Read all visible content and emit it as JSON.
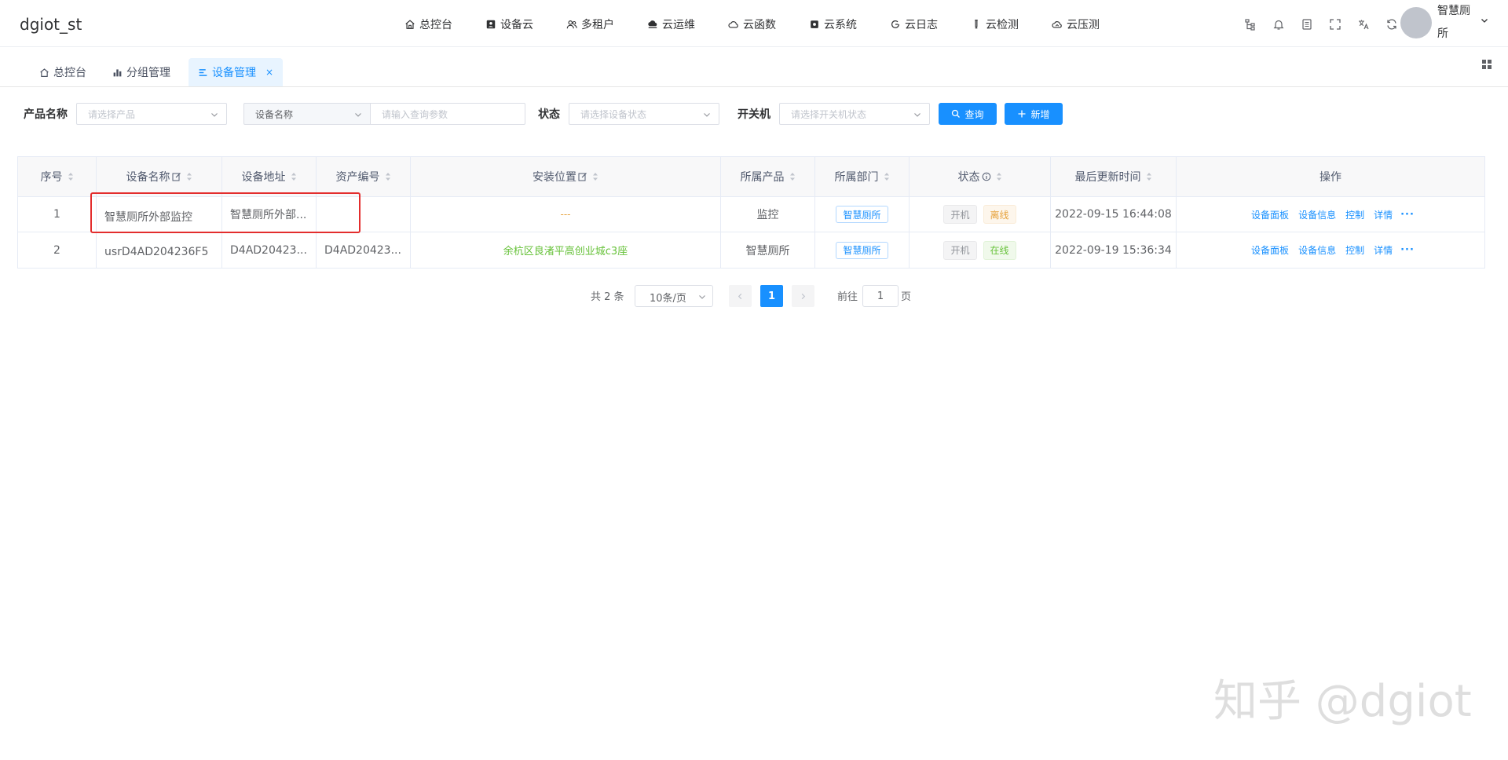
{
  "app": {
    "title": "dgiot_st"
  },
  "nav": {
    "items": [
      {
        "label": "总控台",
        "icon": "home-icon"
      },
      {
        "label": "设备云",
        "icon": "device-card-icon"
      },
      {
        "label": "多租户",
        "icon": "users-icon"
      },
      {
        "label": "云运维",
        "icon": "cloud-ops-icon"
      },
      {
        "label": "云函数",
        "icon": "cloud-function-icon"
      },
      {
        "label": "云系统",
        "icon": "cloud-system-icon"
      },
      {
        "label": "云日志",
        "icon": "cloud-log-icon"
      },
      {
        "label": "云检测",
        "icon": "test-tube-icon"
      },
      {
        "label": "云压测",
        "icon": "cloud-stress-icon"
      }
    ],
    "tools": [
      "tree-icon",
      "bell-icon",
      "document-icon",
      "fullscreen-icon",
      "translate-icon",
      "refresh-icon"
    ],
    "user": {
      "name": "智慧厕所"
    }
  },
  "tags": [
    {
      "label": "总控台",
      "icon": "home-icon"
    },
    {
      "label": "分组管理",
      "icon": "bar-chart-icon"
    },
    {
      "label": "设备管理",
      "icon": "list-icon",
      "active": true
    }
  ],
  "filters": {
    "product_label": "产品名称",
    "product_placeholder": "请选择产品",
    "device_field_value": "设备名称",
    "query_placeholder": "请输入查询参数",
    "status_label": "状态",
    "status_placeholder": "请选择设备状态",
    "power_label": "开关机",
    "power_placeholder": "请选择开关机状态",
    "search_button": "查询",
    "add_button": "新增"
  },
  "table": {
    "headers": [
      "序号",
      "设备名称",
      "设备地址",
      "资产编号",
      "安装位置",
      "所属产品",
      "所属部门",
      "状态",
      "最后更新时间",
      "操作"
    ],
    "rows": [
      {
        "index": "1",
        "name": "智慧厕所外部监控",
        "address": "智慧厕所外部...",
        "asset": "",
        "location": "---",
        "product": "监控",
        "dept": "智慧厕所",
        "power": "开机",
        "status": "离线",
        "updated": "2022-09-15 16:44:08"
      },
      {
        "index": "2",
        "name": "usrD4AD204236F5",
        "address": "D4AD20423...",
        "asset": "D4AD20423...",
        "location": "余杭区良渚平高创业城c3座",
        "product": "智慧厕所",
        "dept": "智慧厕所",
        "power": "开机",
        "status": "在线",
        "updated": "2022-09-19 15:36:34"
      }
    ],
    "actions": [
      "设备面板",
      "设备信息",
      "控制",
      "详情",
      "···"
    ]
  },
  "pagination": {
    "total_text": "共 2 条",
    "page_size": "10条/页",
    "current_page": "1",
    "goto_label": "前往",
    "goto_value": "1",
    "page_suffix": "页"
  },
  "watermark": "知乎 @dgiot",
  "colors": {
    "primary": "#1890ff",
    "online": "#67c23a",
    "offline": "#e6a23c",
    "highlight": "#e32d2d"
  }
}
